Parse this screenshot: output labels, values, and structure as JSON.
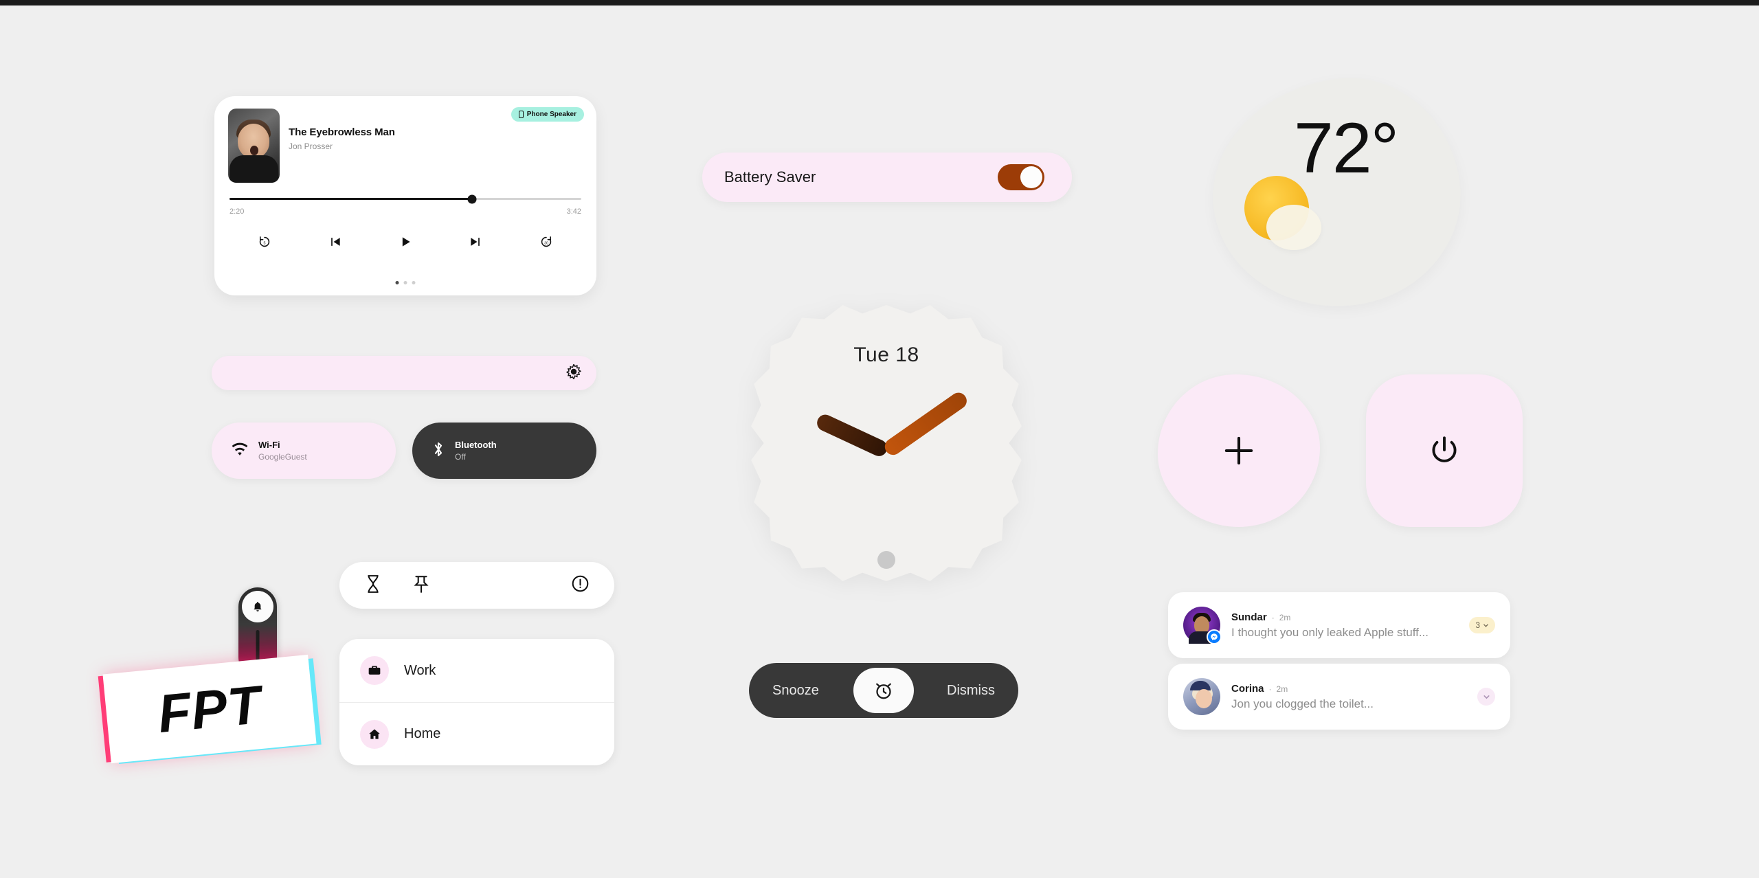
{
  "theme": {
    "background": "#efefef",
    "card_white": "#ffffff",
    "pink_tile": "#fbeaf7",
    "dark_tile": "#383838",
    "mint_chip": "#a7f0e0",
    "accent_brown": "#9c3c07",
    "clock_hour": "#3a1b07",
    "clock_minute": "#b74d0a",
    "sun_yellow": "#f5b51e",
    "badge_yellow": "#fbf0cc",
    "logo_pink": "#ff3d77",
    "logo_cyan": "#67e8f9"
  },
  "media_player": {
    "title": "The Eyebrowless Man",
    "artist": "Jon Prosser",
    "output_chip": {
      "label": "Phone Speaker",
      "icon": "phone-icon"
    },
    "elapsed": "2:20",
    "duration": "3:42",
    "progress_percent": 69,
    "controls": [
      {
        "name": "replay-5-icon",
        "label": "5"
      },
      {
        "name": "previous-track-icon",
        "label": ""
      },
      {
        "name": "play-icon",
        "label": ""
      },
      {
        "name": "next-track-icon",
        "label": ""
      },
      {
        "name": "forward-30-icon",
        "label": "30"
      }
    ],
    "page_dots": 3,
    "active_dot": 1
  },
  "brightness_slider": {
    "icon": "brightness-icon",
    "value_percent": 100
  },
  "quick_tiles": [
    {
      "name": "wifi",
      "icon": "wifi-icon",
      "label": "Wi-Fi",
      "sub": "GoogleGuest",
      "state": "on"
    },
    {
      "name": "bluetooth",
      "icon": "bluetooth-icon",
      "label": "Bluetooth",
      "sub": "Off",
      "state": "off"
    }
  ],
  "action_pill": {
    "items": [
      {
        "name": "hourglass-icon",
        "label": "Hourglass"
      },
      {
        "name": "pin-icon",
        "label": "Pin"
      }
    ],
    "trailing": {
      "name": "info-icon",
      "label": "Info"
    }
  },
  "places_list": [
    {
      "icon": "briefcase-icon",
      "label": "Work"
    },
    {
      "icon": "home-icon",
      "label": "Home"
    }
  ],
  "logo": {
    "text": "FPT",
    "bell_icon": "bell-icon"
  },
  "battery_saver": {
    "label": "Battery Saver",
    "enabled": true
  },
  "clock": {
    "date_label": "Tue 18",
    "hour_angle_deg": 205,
    "minute_angle_deg": -35
  },
  "alarm_actions": {
    "snooze_label": "Snooze",
    "dismiss_label": "Dismiss",
    "center_icon": "alarm-clock-icon"
  },
  "weather": {
    "temperature": "72°",
    "icon": "sun-behind-cloud-icon"
  },
  "round_buttons": [
    {
      "name": "add-button",
      "icon": "plus-icon",
      "label": "Add"
    },
    {
      "name": "power-button",
      "icon": "power-icon",
      "label": "Power"
    }
  ],
  "notifications": [
    {
      "name": "Sundar",
      "time": "2m",
      "separator": "·",
      "message": "I thought you only leaked Apple stuff...",
      "count": "3",
      "app_icon": "messenger-icon",
      "expand_icon": "chevron-down-icon"
    },
    {
      "name": "Corina",
      "time": "2m",
      "separator": "·",
      "message": "Jon you clogged the toilet...",
      "count": "",
      "app_icon": "",
      "expand_icon": "chevron-down-icon"
    }
  ]
}
